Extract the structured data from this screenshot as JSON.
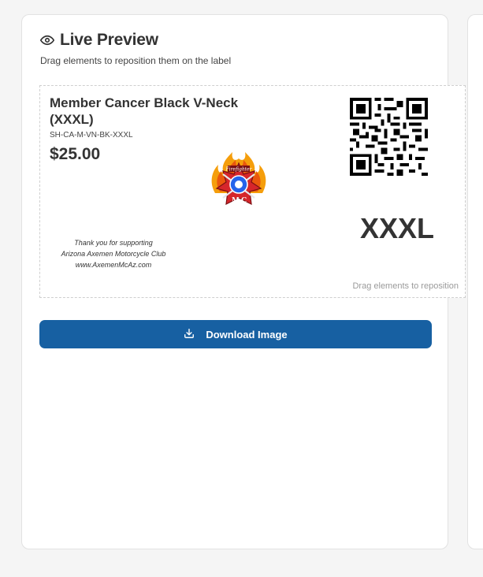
{
  "panel": {
    "title": "Live Preview",
    "subtitle": "Drag elements to reposition them on the label",
    "eye_icon": "eye-icon"
  },
  "label": {
    "product_name": "Member Cancer Black V-Neck (XXXL)",
    "sku": "SH-CA-M-VN-BK-XXXL",
    "price": "$25.00",
    "logo_icon": "firefighter-mc-badge-logo",
    "thanks_lines": [
      "Thank you for supporting",
      "Arizona Axemen Motorcycle Club",
      "www.AxemenMcAz.com"
    ],
    "qr_icon": "qr-code",
    "size": "XXXL",
    "drag_hint": "Drag elements to reposition"
  },
  "actions": {
    "download_label": "Download Image",
    "download_icon": "download-icon"
  },
  "colors": {
    "primary_button": "#1760a2",
    "text_dark": "#333333",
    "border": "#e2e2e2"
  }
}
